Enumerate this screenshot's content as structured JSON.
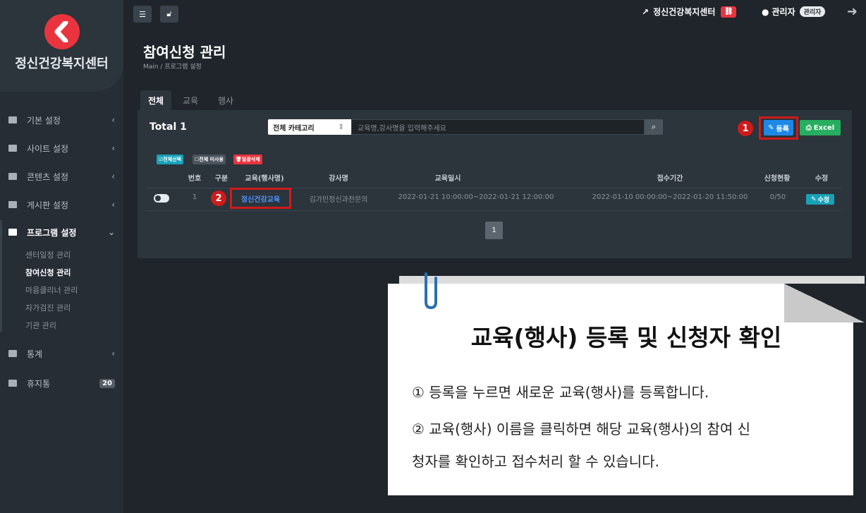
{
  "sidebar": {
    "org_name": "정신건강복지센터",
    "menu": [
      {
        "label": "기본 설정",
        "icon": "gear-icon",
        "arrow": "‹"
      },
      {
        "label": "사이트 설정",
        "icon": "window-icon",
        "arrow": "‹"
      },
      {
        "label": "콘텐츠 설정",
        "icon": "content-icon",
        "arrow": "‹"
      },
      {
        "label": "게시판 설정",
        "icon": "board-icon",
        "arrow": "‹"
      },
      {
        "label": "프로그램 설정",
        "icon": "sitemap-icon",
        "arrow": "⌄"
      },
      {
        "label": "통계",
        "icon": "chart-icon",
        "arrow": "‹"
      },
      {
        "label": "휴지통",
        "icon": "trash-icon",
        "count": "20"
      }
    ],
    "submenu": [
      "센터일정 관리",
      "참여신청 관리",
      "마음클리너 관리",
      "자가검진 관리",
      "기관 관리"
    ]
  },
  "topbar": {
    "site_link": "정신건강복지센터",
    "user": "관리자",
    "user_badge": "관리자"
  },
  "page": {
    "title": "참여신청 관리",
    "breadcrumb": "Main / 프로그램 설정"
  },
  "tabs": [
    "전체",
    "교육",
    "행사"
  ],
  "toolbar": {
    "total": "Total 1",
    "category": "전체 카테고리",
    "search_placeholder": "교육명,강사명을 입력해주세요",
    "register": "등록",
    "excel": "Excel"
  },
  "bulk": [
    "전체선택",
    "전체 미사용",
    "일괄삭제"
  ],
  "table": {
    "headers": [
      "번호",
      "구분",
      "교육(행사명)",
      "강사명",
      "교육일시",
      "접수기간",
      "신청현황",
      "수정"
    ],
    "row": {
      "no": "1",
      "name": "정신건강교육",
      "instructor": "김가민정신과전문의",
      "date": "2022-01-21 10:00:00~2022-01-21 12:00:00",
      "period": "2022-01-10 00:00:00~2022-01-20 11:50:00",
      "status": "0/50",
      "edit": "수정"
    }
  },
  "pagination": {
    "current": "1"
  },
  "markers": [
    "1",
    "2"
  ],
  "card": {
    "title": "교육(행사) 등록 및 신청자 확인",
    "lines": [
      "① 등록을 누르면 새로운 교육(행사)를 등록합니다.",
      "② 교육(행사) 이름을 클릭하면 해당 교육(행사)의 참여 신",
      "청자를 확인하고 접수처리 할 수 있습니다."
    ]
  },
  "colors": {
    "accent_red": "#d01b1b",
    "register_blue": "#1e88e5",
    "excel_green": "#27ae60",
    "edit_teal": "#17a2b8"
  }
}
